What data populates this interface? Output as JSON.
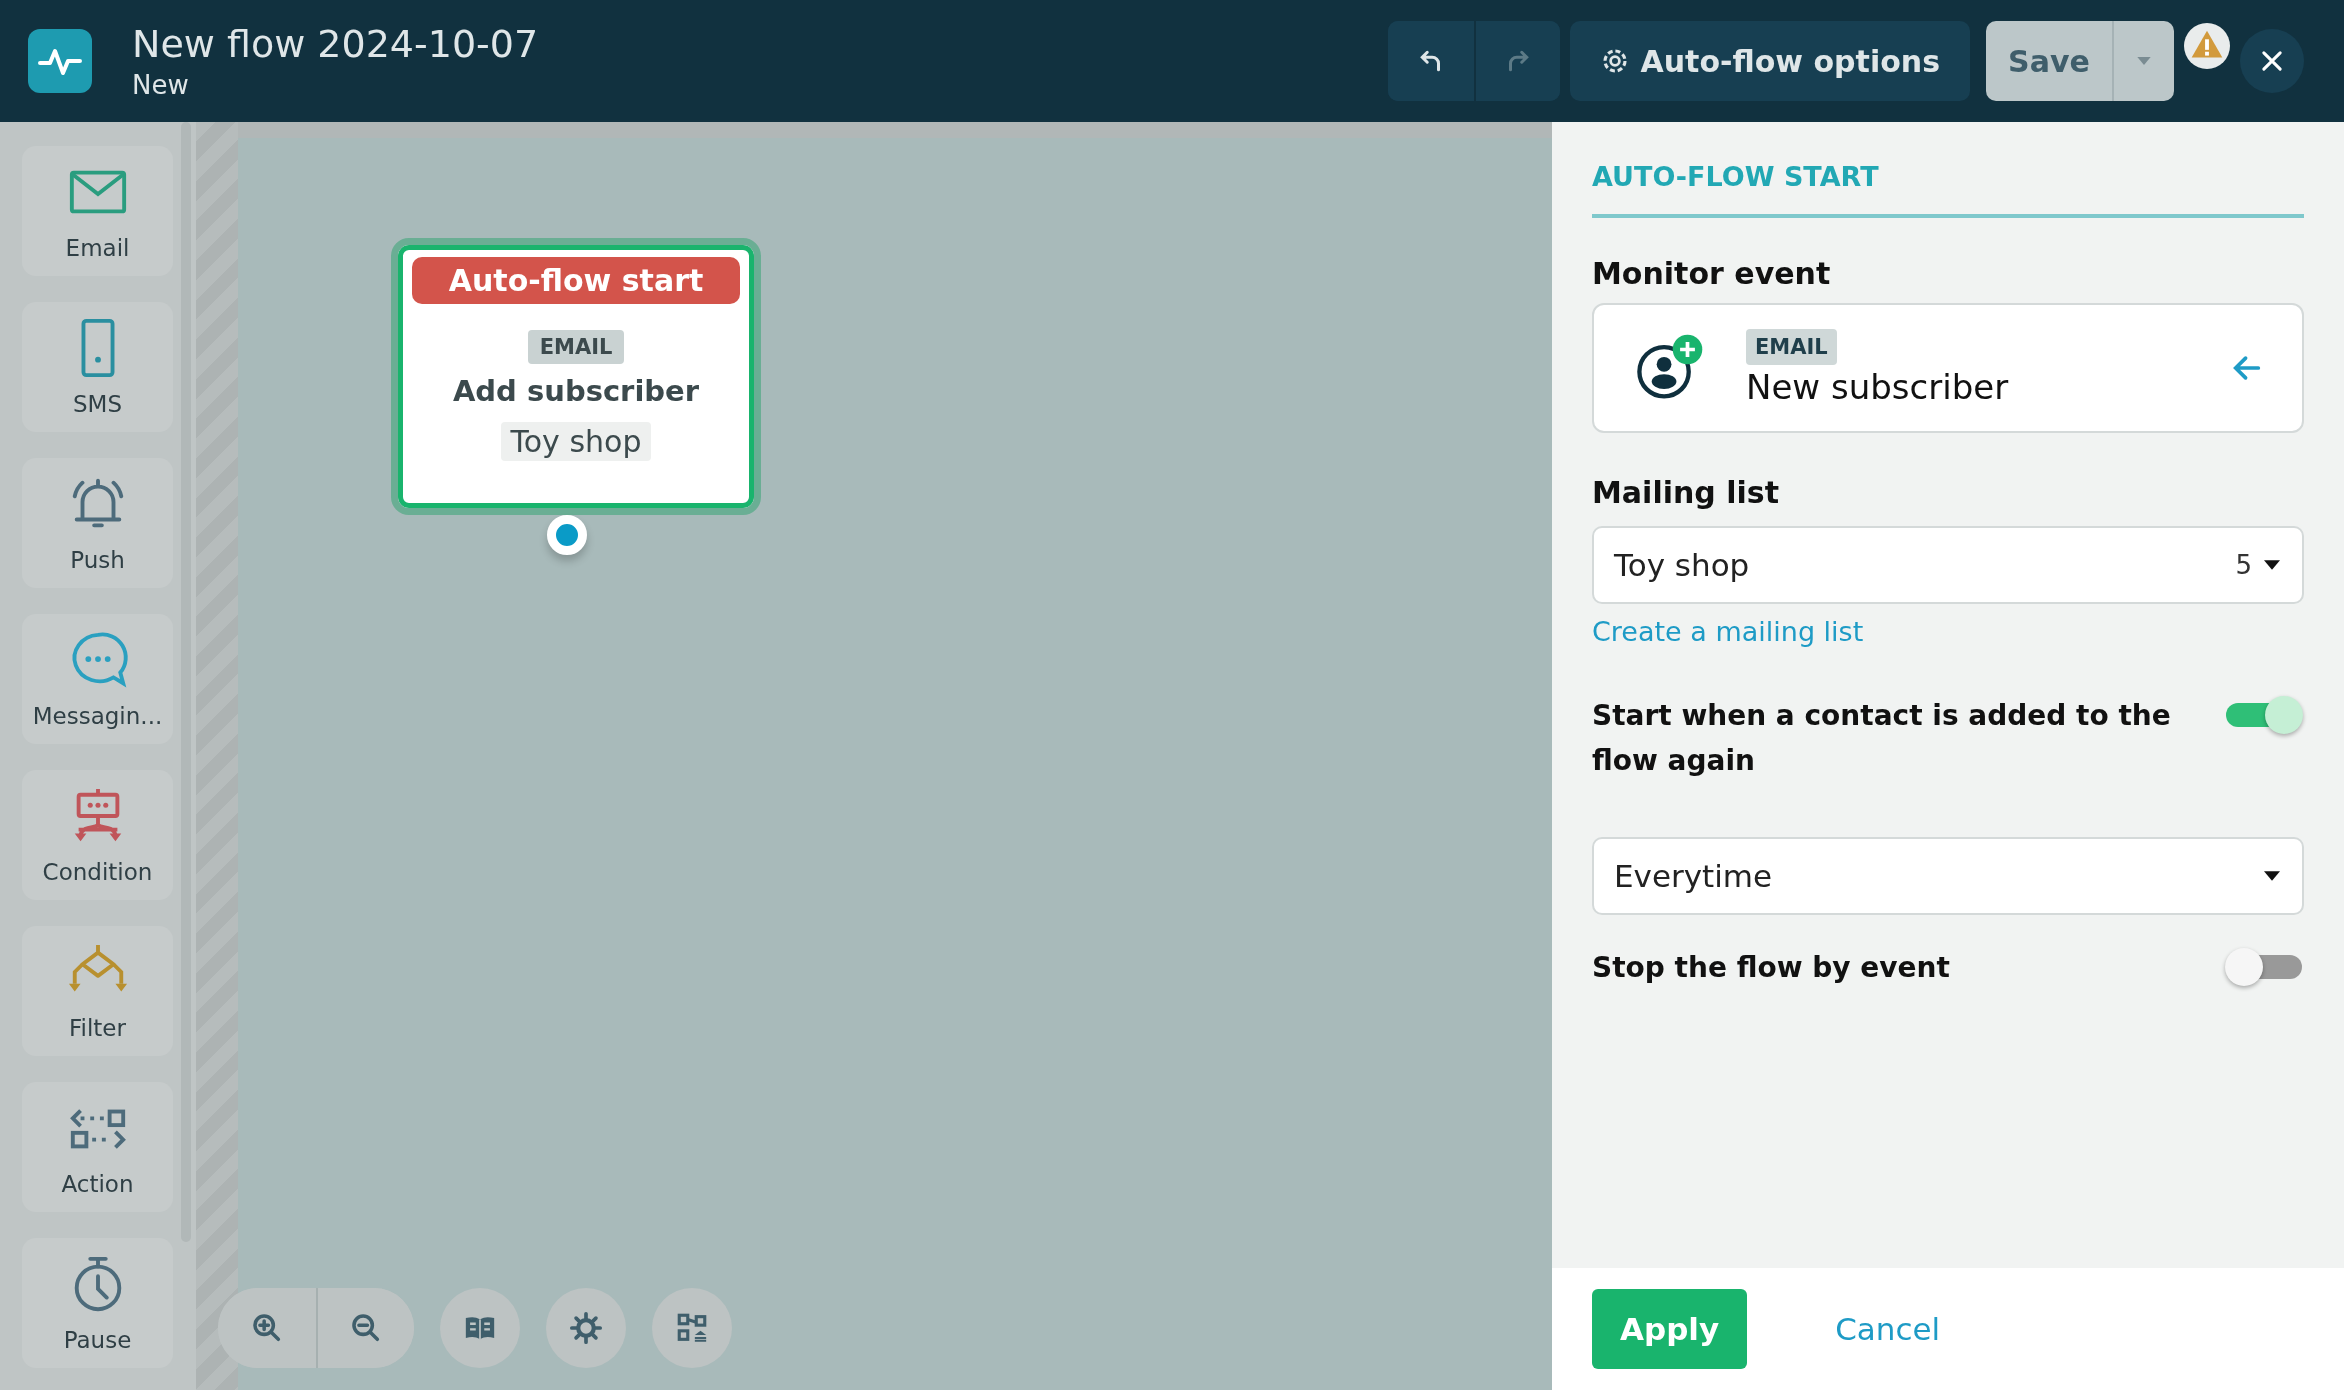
{
  "header": {
    "title": "New flow 2024-10-07",
    "subtitle": "New",
    "undo": {
      "disabled": false
    },
    "redo": {
      "disabled": true
    },
    "options_button": "Auto-flow options",
    "save_button": "Save",
    "warning": true
  },
  "palette": [
    {
      "label": "Email",
      "kind": "email"
    },
    {
      "label": "SMS",
      "kind": "sms"
    },
    {
      "label": "Push",
      "kind": "push"
    },
    {
      "label": "Messagin...",
      "kind": "messaging"
    },
    {
      "label": "Condition",
      "kind": "condition"
    },
    {
      "label": "Filter",
      "kind": "filter"
    },
    {
      "label": "Action",
      "kind": "action"
    },
    {
      "label": "Pause",
      "kind": "pause"
    }
  ],
  "node": {
    "title": "Auto-flow start",
    "tag": "EMAIL",
    "event": "Add subscriber",
    "list": "Toy shop",
    "selected": true
  },
  "canvas_tools": [
    {
      "kind": "zoom"
    },
    {
      "kind": "guide"
    },
    {
      "kind": "settings"
    },
    {
      "kind": "layout"
    }
  ],
  "panel": {
    "heading": "AUTO-FLOW START",
    "monitor_label": "Monitor event",
    "event": {
      "tag": "EMAIL",
      "name": "New subscriber"
    },
    "mailing_label": "Mailing list",
    "mailing": {
      "value": "Toy shop",
      "count": "5"
    },
    "create_link": "Create a mailing list",
    "repeat": {
      "label": "Start when a contact is added to the flow again",
      "on": true
    },
    "repeat_select": {
      "value": "Everytime"
    },
    "stop": {
      "label": "Stop the flow by event",
      "on": false
    },
    "apply": "Apply",
    "cancel": "Cancel"
  }
}
